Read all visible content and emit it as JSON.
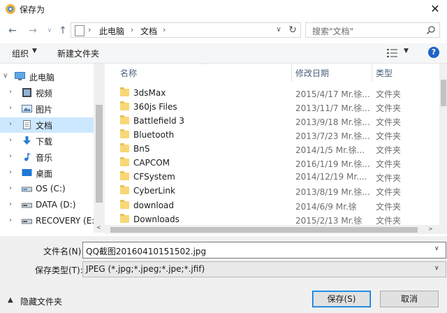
{
  "window": {
    "title": "保存为",
    "close_label": "✕"
  },
  "address": {
    "crumbs": [
      "此电脑",
      "文档"
    ],
    "separator": "›",
    "search_placeholder": "搜索\"文档\""
  },
  "toolbar": {
    "organize_label": "组织",
    "new_folder_label": "新建文件夹",
    "help_label": "?"
  },
  "tree": {
    "items": [
      {
        "label": "此电脑",
        "icon": "computer-icon"
      },
      {
        "label": "视频",
        "icon": "video-icon"
      },
      {
        "label": "图片",
        "icon": "pictures-icon"
      },
      {
        "label": "文档",
        "icon": "document-icon",
        "selected": true
      },
      {
        "label": "下载",
        "icon": "download-icon"
      },
      {
        "label": "音乐",
        "icon": "music-icon"
      },
      {
        "label": "桌面",
        "icon": "desktop-icon"
      },
      {
        "label": "OS (C:)",
        "icon": "drive-icon"
      },
      {
        "label": "DATA (D:)",
        "icon": "drive-icon"
      },
      {
        "label": "RECOVERY (E:)",
        "icon": "drive-icon"
      }
    ]
  },
  "list": {
    "columns": [
      "名称",
      "修改日期",
      "类型"
    ],
    "rows": [
      {
        "name": "3dsMax",
        "date": "2015/4/17 Mr.徐...",
        "type": "文件夹"
      },
      {
        "name": "360js Files",
        "date": "2013/11/7 Mr.徐...",
        "type": "文件夹"
      },
      {
        "name": "Battlefield 3",
        "date": "2013/9/18 Mr.徐...",
        "type": "文件夹"
      },
      {
        "name": "Bluetooth",
        "date": "2013/7/23 Mr.徐...",
        "type": "文件夹"
      },
      {
        "name": "BnS",
        "date": "2014/1/5 Mr.徐...",
        "type": "文件夹"
      },
      {
        "name": "CAPCOM",
        "date": "2016/1/19 Mr.徐...",
        "type": "文件夹"
      },
      {
        "name": "CFSystem",
        "date": "2014/12/19 Mr....",
        "type": "文件夹"
      },
      {
        "name": "CyberLink",
        "date": "2013/8/19 Mr.徐...",
        "type": "文件夹"
      },
      {
        "name": "download",
        "date": "2014/6/9 Mr.徐",
        "type": "文件夹"
      },
      {
        "name": "Downloads",
        "date": "2015/2/13 Mr.徐",
        "type": "文件夹"
      }
    ]
  },
  "bottom": {
    "filename_label": "文件名(N):",
    "filename_value": "QQ截图20160410151502.jpg",
    "type_label": "保存类型(T):",
    "type_value": "JPEG (*.jpg;*.jpeg;*.jpe;*.jfif)",
    "hide_folders_label": "隐藏文件夹",
    "save_label": "保存(S)",
    "cancel_label": "取消"
  },
  "colors": {
    "selection": "#cce8ff",
    "accent": "#0078d7",
    "folder": "#f8d775"
  }
}
